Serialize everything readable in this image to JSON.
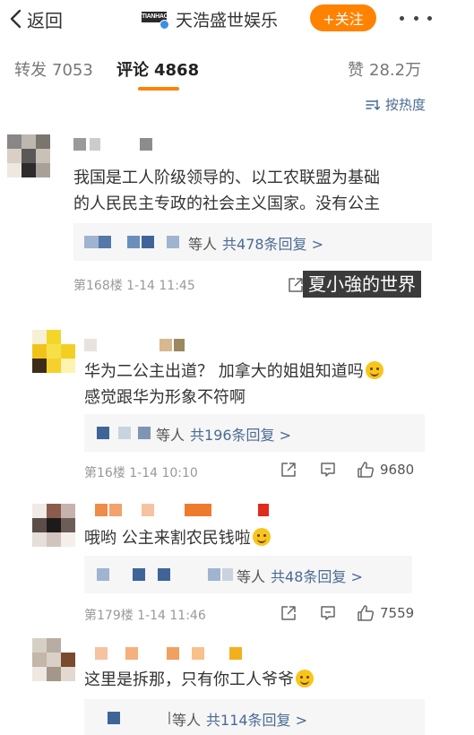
{
  "header": {
    "back_label": "返回",
    "brand_name": "天浩盛世娱乐",
    "brand_logo_text": "TIANHAO",
    "follow_label": "+关注"
  },
  "tabs": {
    "repost_label": "转发",
    "repost_count": "7053",
    "comment_label": "评论",
    "comment_count": "4868",
    "like_label": "赞",
    "like_count": "28.2万"
  },
  "sort_label": "按热度",
  "watermark": "夏小強的世界",
  "comments": [
    {
      "line1": "我国是工人阶级领导的、以工农联盟为基础",
      "line2": "的人民民主专政的社会主义国家。没有公主",
      "reply_prefix": "等人",
      "reply_link": "共478条回复 >",
      "meta": "第168楼 1-14 11:45"
    },
    {
      "line1": "华为二公主出道？ 加拿大的姐姐知道吗",
      "line2": "感觉跟华为形象不符啊",
      "reply_prefix": "等人",
      "reply_link": "共196条回复 >",
      "meta": "第16楼 1-14 10:10",
      "likes": "9680"
    },
    {
      "line1": "哦哟 公主来割农民钱啦",
      "reply_prefix": "等人",
      "reply_link": "共48条回复 >",
      "meta": "第179楼 1-14 11:46",
      "likes": "7559"
    },
    {
      "line1": "这里是拆那，只有你工人爷爷",
      "reply_prefix": "等人",
      "reply_link": "共114条回复 >"
    }
  ],
  "colors": {
    "accent": "#ff8200",
    "link": "#4a6b93",
    "verified": "#3a8ee6"
  },
  "icons": [
    "chevron-left-icon",
    "more-dots-icon",
    "sort-icon",
    "share-icon",
    "comment-icon",
    "like-icon",
    "emoji-icon",
    "verified-badge-icon"
  ]
}
